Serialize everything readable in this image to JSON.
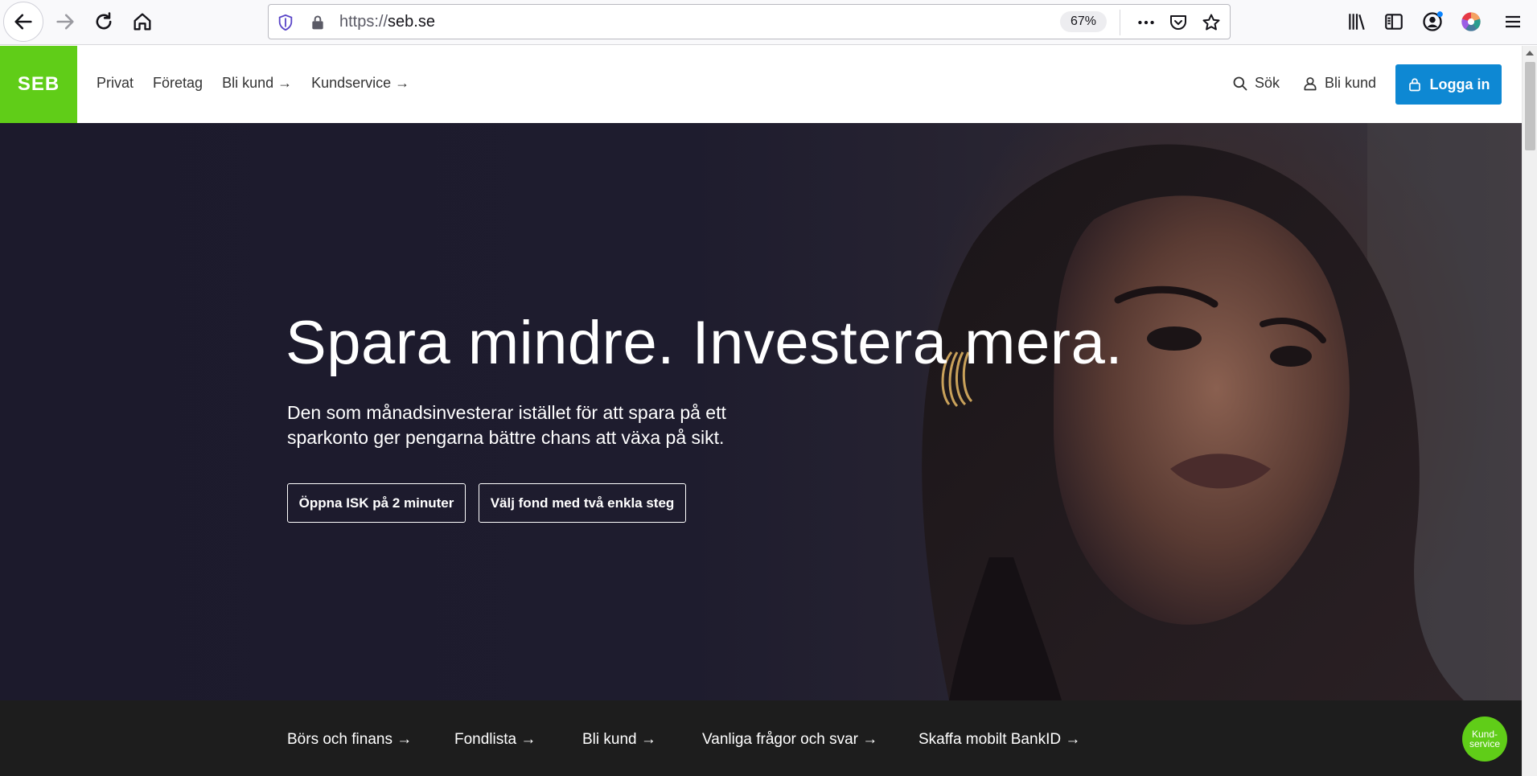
{
  "browser": {
    "url_scheme": "https://",
    "url_host": "seb.se",
    "zoom": "67%",
    "icons": [
      "back-icon",
      "forward-icon",
      "reload-icon",
      "home-icon",
      "tracking-shield-icon",
      "lock-icon",
      "more-icon",
      "pocket-icon",
      "star-icon",
      "library-icon",
      "sidebar-icon",
      "account-icon",
      "color-extension-icon",
      "menu-icon"
    ]
  },
  "header": {
    "logo": "SEB",
    "nav": [
      "Privat",
      "Företag",
      "Bli kund →",
      "Kundservice →"
    ],
    "search_label": "Sök",
    "become_customer_label": "Bli kund",
    "login_label": "Logga in"
  },
  "hero": {
    "title": "Spara mindre. Investera mera.",
    "text": "Den som månadsinvesterar istället för att spara på ett sparkonto ger pengarna bättre chans att växa på sikt.",
    "button_isk": "Öppna ISK på 2 minuter",
    "button_fund": "Välj fond med två enkla steg"
  },
  "links": [
    "Börs och finans →",
    "Fondlista →",
    "Bli kund →",
    "Vanliga frågor och svar →",
    "Skaffa mobilt BankID →"
  ],
  "kundservice_bubble": "Kund-\nservice",
  "colors": {
    "brand_green": "#60cd18",
    "login_blue": "#0e88d3",
    "hero_dark": "#1c1a2c",
    "bar_dark": "#1d1d1d"
  }
}
